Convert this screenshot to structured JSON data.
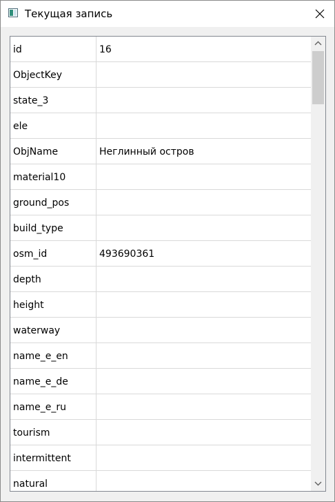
{
  "window": {
    "title": "Текущая запись"
  },
  "record": {
    "rows": [
      {
        "key": "id",
        "value": "16"
      },
      {
        "key": "ObjectKey",
        "value": ""
      },
      {
        "key": "state_3",
        "value": ""
      },
      {
        "key": "ele",
        "value": ""
      },
      {
        "key": "ObjName",
        "value": "Неглинный остров"
      },
      {
        "key": "material10",
        "value": ""
      },
      {
        "key": "ground_pos",
        "value": ""
      },
      {
        "key": "build_type",
        "value": ""
      },
      {
        "key": "osm_id",
        "value": "493690361"
      },
      {
        "key": "depth",
        "value": ""
      },
      {
        "key": "height",
        "value": ""
      },
      {
        "key": "waterway",
        "value": ""
      },
      {
        "key": "name_e_en",
        "value": ""
      },
      {
        "key": "name_e_de",
        "value": ""
      },
      {
        "key": "name_e_ru",
        "value": ""
      },
      {
        "key": "tourism",
        "value": ""
      },
      {
        "key": "intermittent",
        "value": ""
      },
      {
        "key": "natural",
        "value": ""
      }
    ]
  },
  "icons": {
    "app": "table-window-icon",
    "close": "close-icon",
    "up": "chevron-up-icon",
    "down": "chevron-down-icon"
  }
}
